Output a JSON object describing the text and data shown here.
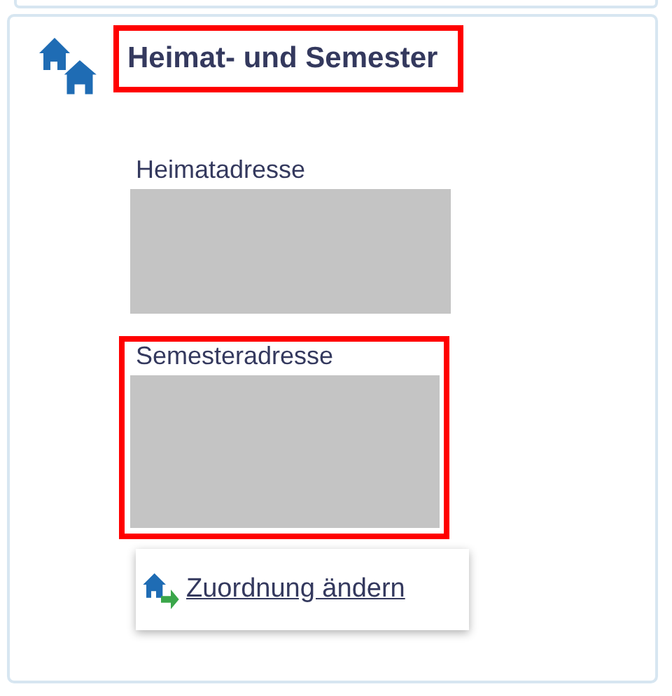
{
  "card": {
    "title": {
      "text": "Heimat- und Semester",
      "highlighted": true
    },
    "addresses": [
      {
        "label": "Heimatadresse",
        "highlighted": false
      },
      {
        "label": "Semesteradresse",
        "highlighted": true
      }
    ],
    "action": {
      "label": "Zuordnung ändern"
    }
  }
}
